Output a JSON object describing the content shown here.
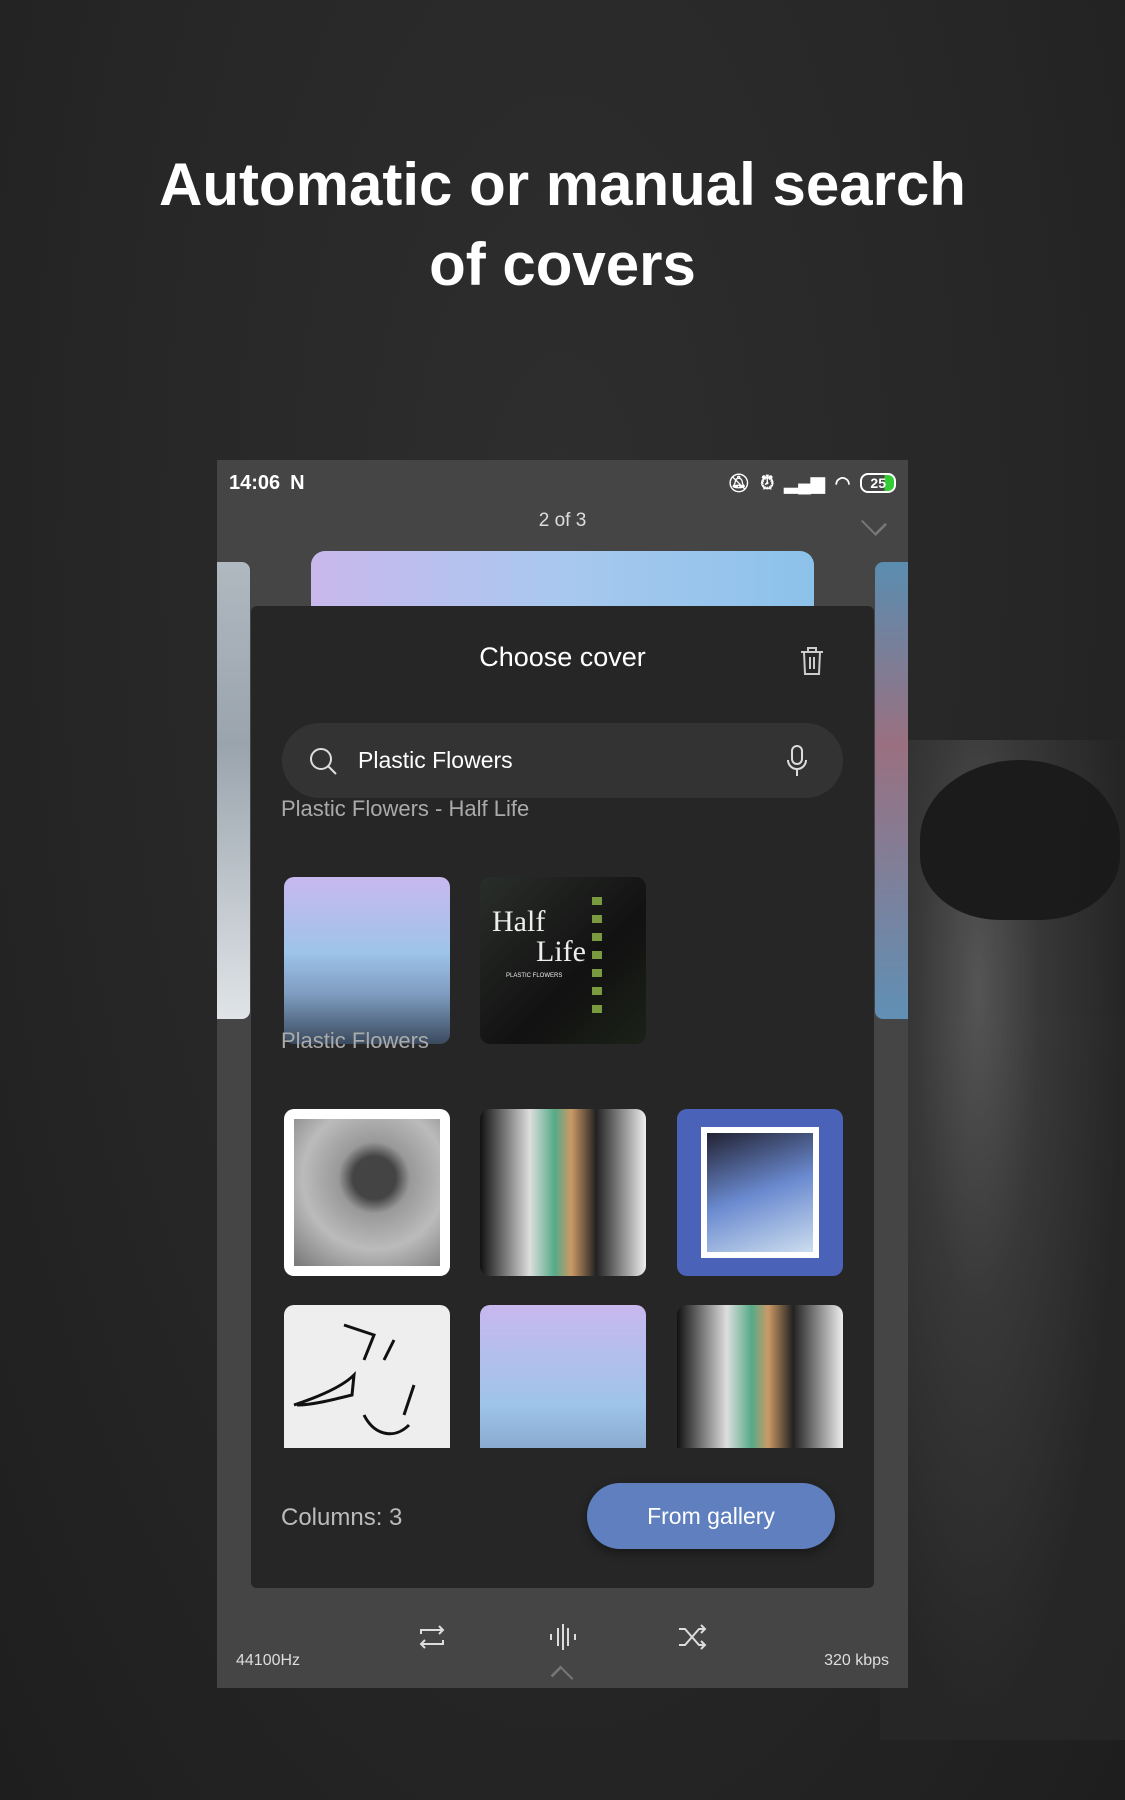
{
  "headline": {
    "line1": "Automatic or manual search",
    "line2": "of covers"
  },
  "status_bar": {
    "time": "14:06",
    "notification_icon": "n-icon",
    "battery": "25",
    "icons": [
      "mute-icon",
      "alarm-icon",
      "signal-icon",
      "wifi-icon",
      "battery-icon"
    ]
  },
  "player": {
    "pager": "2 of 3",
    "sample_rate": "44100Hz",
    "bitrate": "320 kbps",
    "controls": [
      "repeat-icon",
      "equalizer-icon",
      "shuffle-icon"
    ]
  },
  "dialog": {
    "title": "Choose cover",
    "search": {
      "value": "Plastic Flowers",
      "placeholder": ""
    },
    "sections": [
      {
        "label": "Plastic Flowers - Half Life",
        "covers": [
          "mist-blue",
          "half-life"
        ]
      },
      {
        "label": "Plastic Flowers",
        "covers": [
          "portrait",
          "forest-glitch",
          "waterfall-blue",
          "line-drawing",
          "mist-blue",
          "forest-glitch"
        ]
      }
    ],
    "half_life_cover": {
      "title_line1": "Half",
      "title_line2": "Life",
      "artist": "PLASTIC FLOWERS"
    },
    "columns_label": "Columns: 3",
    "gallery_button": "From gallery"
  },
  "colors": {
    "accent": "#5f7fbf",
    "dialog_bg": "#262626",
    "player_bg": "#454545"
  }
}
